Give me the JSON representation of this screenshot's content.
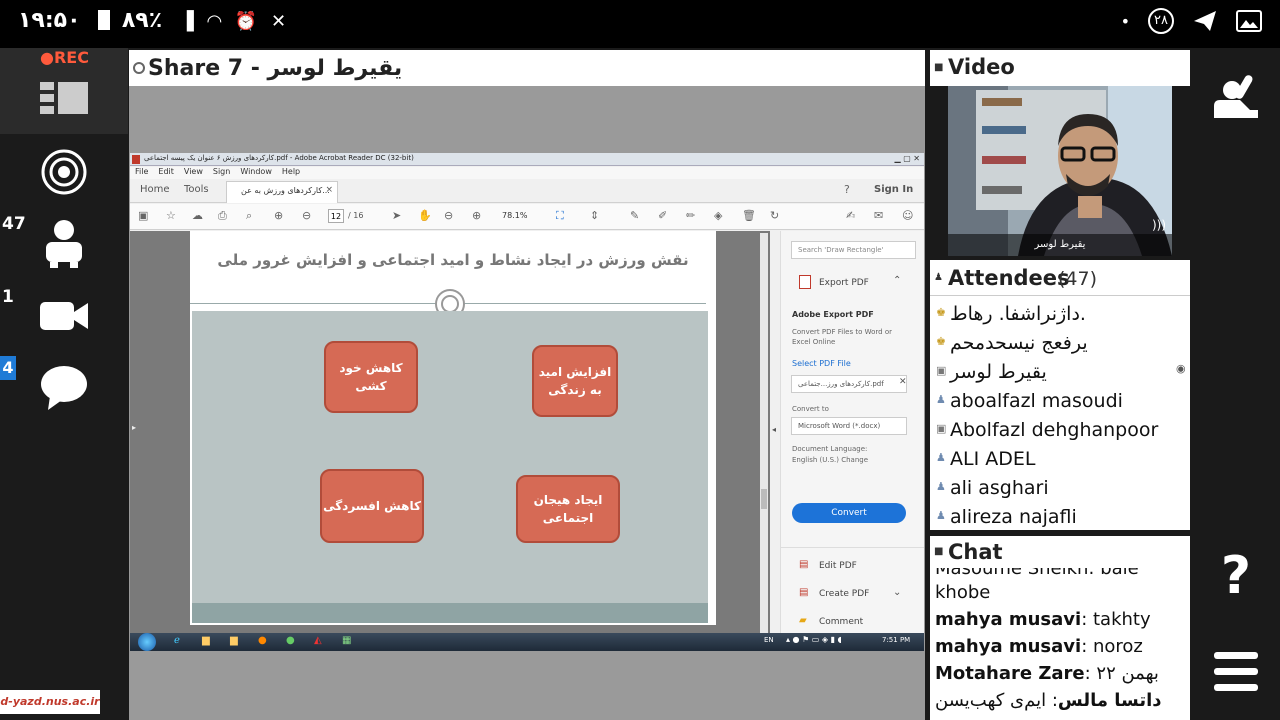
{
  "status_bar": {
    "time": "۱۹:۵۰",
    "battery": "۸۹٪",
    "notif_count": "۲۸",
    "dot": "•"
  },
  "rec_label": "●REC",
  "rail": {
    "participants_count": "47",
    "video_count": "1",
    "chat_count": "4"
  },
  "share": {
    "title": "Share 7 - یقیرط لوسر"
  },
  "acrobat": {
    "title": "کارکردهای ورزش ۶ عنوان یک پیسه اجتماعی.pdf - Adobe Acrobat Reader DC (32-bit)",
    "menus": [
      "File",
      "Edit",
      "View",
      "Sign",
      "Window",
      "Help"
    ],
    "tab_home": "Home",
    "tab_tools": "Tools",
    "doc_tab": "کارکردهای ورزش به عن...",
    "sign_in": "Sign In",
    "page_current": "12",
    "page_total": "/ 16",
    "zoom": "78.1%",
    "slide_title": "نقش ورزش در ایجاد نشاط و امید اجتماعی و افزایش غرور ملی",
    "cards": [
      "کاهش خود کشی",
      "افزایش امید به زندگی",
      "کاهش افسردگی",
      "ایجاد هیجان اجتماعی"
    ],
    "search_placeholder": "Search 'Draw Rectangle'",
    "export_pdf": "Export PDF",
    "adobe_export_title": "Adobe Export PDF",
    "adobe_export_desc": "Convert PDF Files to Word or Excel Online",
    "select_pdf": "Select PDF File",
    "selected_file": "کارکردهای ورز...جتماعی.pdf",
    "convert_to": "Convert to",
    "format": "Microsoft Word (*.docx)",
    "doc_language_label": "Document Language:",
    "doc_language": "English (U.S.) Change",
    "convert_btn": "Convert",
    "edit_pdf": "Edit PDF",
    "create_pdf": "Create PDF",
    "comment": "Comment"
  },
  "taskbar": {
    "lang": "EN",
    "clock": "7:51 PM"
  },
  "video": {
    "title": "Video",
    "name_tag": "یقیرط لوسر"
  },
  "attendees": {
    "title": "Attendees",
    "count": "(47)",
    "list": [
      "داژنراشفا. رهاط.",
      "یرفعج نیسحدمحم",
      "یقیرط لوسر",
      "aboalfazl masoudi",
      "Abolfazl dehghanpoor",
      "ALI  ADEL",
      "ali asghari",
      "alireza najafli"
    ]
  },
  "chat": {
    "title": "Chat",
    "partial_top": "Masoume Sheikh: bale",
    "partial_cont": "khobe",
    "messages": [
      {
        "author": "mahya musavi",
        "text": ": takhty"
      },
      {
        "author": "mahya musavi",
        "text": ": noroz"
      },
      {
        "author": "Motahare Zare",
        "text": ": ۲۲ بهمن"
      },
      {
        "author": "داتسا مالس",
        "text": ": ایم‌ی کهب‌یسن"
      }
    ]
  },
  "watermark": "d-yazd.nus.ac.ir"
}
